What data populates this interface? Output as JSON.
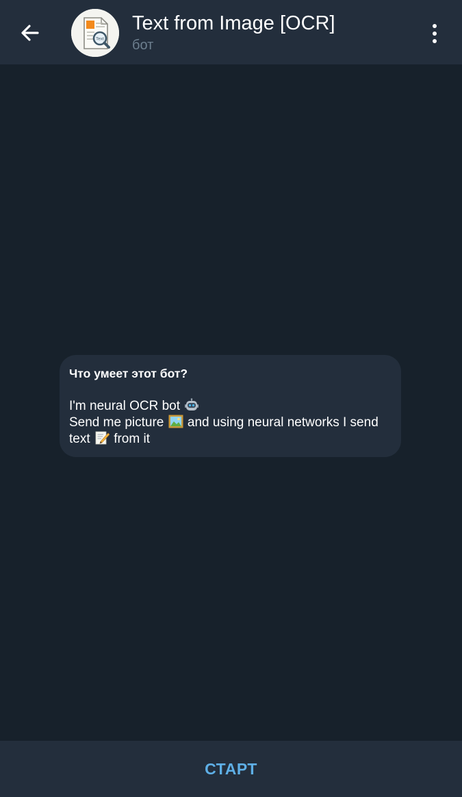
{
  "header": {
    "back_icon": "arrow-left-icon",
    "avatar_icon": "document-magnifier-icon",
    "avatar_badge_text": "Text",
    "title": "Text from Image [OCR]",
    "subtitle": "бот",
    "menu_icon": "more-vertical-icon"
  },
  "chat": {
    "intro": {
      "heading": "Что умеет этот бот?",
      "line1_text": "I'm neural OCR bot",
      "line1_emoji": "robot-face-emoji",
      "line2_prefix": "Send me picture",
      "line2_emoji": "framed-picture-emoji",
      "line2_suffix": "and using neural networks I send",
      "line3_prefix": "text",
      "line3_emoji": "memo-emoji",
      "line3_suffix": "from it"
    }
  },
  "footer": {
    "start_label": "СТАРТ"
  },
  "colors": {
    "background": "#17212b",
    "bar": "#232e3c",
    "bubble": "#232e3c",
    "accent": "#5eafe6",
    "subtitle": "#6d7f8f",
    "text": "#ffffff"
  }
}
